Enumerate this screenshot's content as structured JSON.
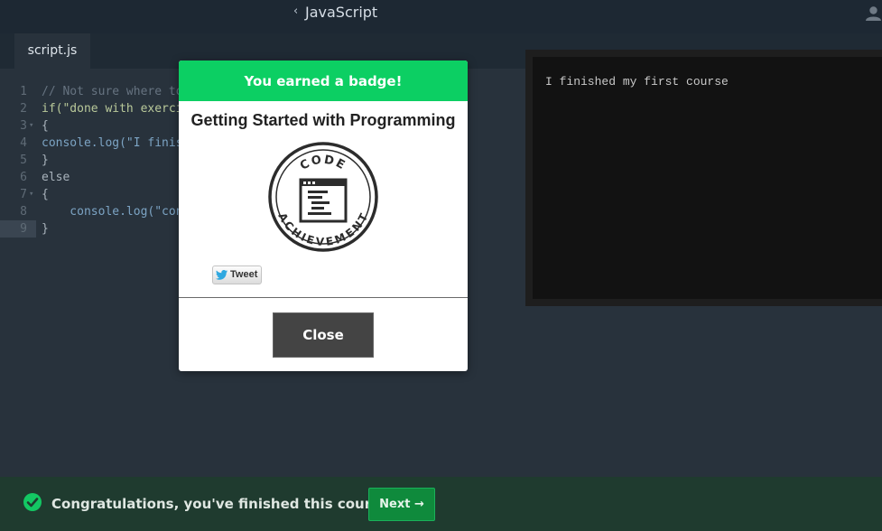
{
  "topbar": {
    "back_glyph": "‹",
    "title": "JavaScript",
    "user_icon": "user-icon"
  },
  "tabs": [
    {
      "label": "script.js"
    }
  ],
  "editor": {
    "lines": [
      {
        "n": "1",
        "text": "// Not sure where to"
      },
      {
        "n": "2",
        "text": "if(\"done with exerci"
      },
      {
        "n": "3",
        "text": "{"
      },
      {
        "n": "4",
        "text": "console.log(\"I finis"
      },
      {
        "n": "5",
        "text": "}"
      },
      {
        "n": "6",
        "text": "else"
      },
      {
        "n": "7",
        "text": "{"
      },
      {
        "n": "8",
        "text": "    console.log(\"con"
      },
      {
        "n": "9",
        "text": "}"
      }
    ]
  },
  "console": {
    "output": "I finished my first course"
  },
  "modal": {
    "header": "You earned a badge!",
    "badge_title": "Getting Started with Programming",
    "badge_text_top": "CODE",
    "badge_text_bottom": "ACHIEVEMENT",
    "tweet_label": "Tweet",
    "close_label": "Close"
  },
  "bottombar": {
    "message": "Congratulations, you've finished this course!",
    "next_label": "Next →"
  },
  "colors": {
    "accent_green": "#0ccf63",
    "next_green": "#0f8a3c",
    "bg": "#28323c"
  }
}
